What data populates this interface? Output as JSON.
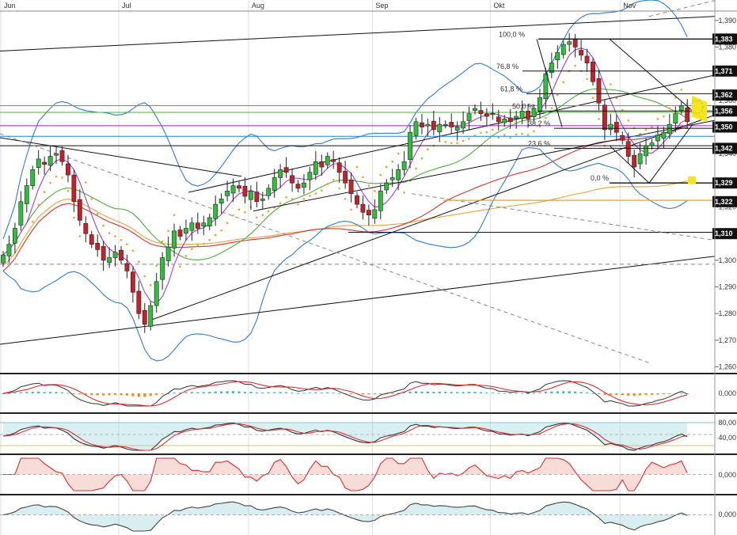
{
  "chart_data": {
    "type": "candlestick",
    "months": [
      "Jun",
      "Jul",
      "Aug",
      "Sep",
      "Okt",
      "Nov"
    ],
    "price_axis": {
      "ylim": [
        1.2575,
        1.3935
      ],
      "ticks": [
        "1,390",
        "1,380",
        "1,370",
        "1,360",
        "1,350",
        "1,340",
        "1,330",
        "1,320",
        "1,310",
        "1,300",
        "1,290",
        "1,280",
        "1,270",
        "1,260"
      ],
      "tick_values": [
        1.39,
        1.38,
        1.37,
        1.36,
        1.35,
        1.34,
        1.33,
        1.32,
        1.31,
        1.3,
        1.29,
        1.28,
        1.27,
        1.26
      ]
    },
    "price_badges": [
      {
        "label": "1,383",
        "value": 1.383
      },
      {
        "label": "1,371",
        "value": 1.371
      },
      {
        "label": "1,362",
        "value": 1.362
      },
      {
        "label": "1,356",
        "value": 1.356
      },
      {
        "label": "1,350",
        "value": 1.35
      },
      {
        "label": "1,342",
        "value": 1.342
      },
      {
        "label": "1,329",
        "value": 1.329
      },
      {
        "label": "1,322",
        "value": 1.322
      },
      {
        "label": "1,310",
        "value": 1.31
      }
    ],
    "fibonacci_levels": [
      {
        "label": "100,0 %",
        "value": 1.383
      },
      {
        "label": "76,8 %",
        "value": 1.371
      },
      {
        "label": "61,8 %",
        "value": 1.3625
      },
      {
        "label": "50,0 %",
        "value": 1.356
      },
      {
        "label": "38,2 %",
        "value": 1.3495
      },
      {
        "label": "23,6 %",
        "value": 1.342
      },
      {
        "label": "0,0 %",
        "value": 1.329
      }
    ],
    "closes": [
      1.302,
      1.306,
      1.312,
      1.322,
      1.328,
      1.334,
      1.338,
      1.336,
      1.339,
      1.34,
      1.337,
      1.332,
      1.322,
      1.315,
      1.31,
      1.306,
      1.304,
      1.3,
      1.301,
      1.303,
      1.3,
      1.296,
      1.288,
      1.28,
      1.276,
      1.283,
      1.292,
      1.301,
      1.305,
      1.311,
      1.309,
      1.312,
      1.314,
      1.312,
      1.314,
      1.316,
      1.321,
      1.323,
      1.326,
      1.328,
      1.327,
      1.324,
      1.326,
      1.322,
      1.323,
      1.327,
      1.331,
      1.334,
      1.333,
      1.329,
      1.327,
      1.329,
      1.333,
      1.337,
      1.335,
      1.339,
      1.337,
      1.333,
      1.329,
      1.325,
      1.321,
      1.318,
      1.317,
      1.319,
      1.326,
      1.329,
      1.331,
      1.334,
      1.337,
      1.348,
      1.352,
      1.35,
      1.351,
      1.349,
      1.351,
      1.351,
      1.35,
      1.35,
      1.352,
      1.355,
      1.357,
      1.355,
      1.354,
      1.355,
      1.352,
      1.353,
      1.352,
      1.354,
      1.356,
      1.353,
      1.357,
      1.361,
      1.37,
      1.374,
      1.378,
      1.381,
      1.382,
      1.38,
      1.377,
      1.374,
      1.367,
      1.359,
      1.349,
      1.351,
      1.348,
      1.345,
      1.339,
      1.335,
      1.34,
      1.343,
      1.344,
      1.347,
      1.348,
      1.351,
      1.355,
      1.358,
      1.352
    ],
    "macd": {
      "label": "0,000"
    },
    "stochastic": {
      "labels": [
        "80,00",
        "40,00"
      ]
    },
    "momentum": {
      "label": "0,000"
    },
    "oscillator": {
      "label": "0,000"
    }
  }
}
